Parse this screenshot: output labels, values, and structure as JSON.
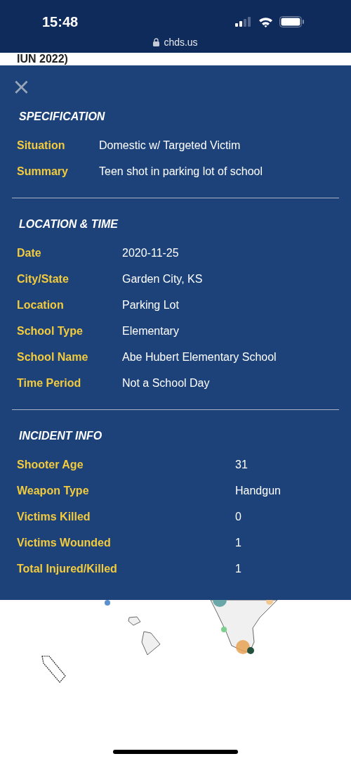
{
  "status_bar": {
    "time": "15:48",
    "url": "chds.us"
  },
  "page_heading": "IUN 2022)",
  "modal": {
    "close": "×",
    "sections": [
      {
        "title": "SPECIFICATION",
        "rows": [
          {
            "label": "Situation",
            "value": "Domestic w/ Targeted Victim"
          },
          {
            "label": "Summary",
            "value": "Teen shot in parking lot of school"
          }
        ]
      },
      {
        "title": "LOCATION & TIME",
        "rows": [
          {
            "label": "Date",
            "value": "2020-11-25"
          },
          {
            "label": "City/State",
            "value": "Garden City, KS"
          },
          {
            "label": "Location",
            "value": "Parking Lot"
          },
          {
            "label": "School Type",
            "value": "Elementary"
          },
          {
            "label": "School Name",
            "value": "Abe Hubert Elementary School"
          },
          {
            "label": "Time Period",
            "value": "Not a School Day"
          }
        ]
      },
      {
        "title": "INCIDENT INFO",
        "rows": [
          {
            "label": "Shooter Age",
            "value": "31"
          },
          {
            "label": "Weapon Type",
            "value": "Handgun"
          },
          {
            "label": "Victims Killed",
            "value": "0"
          },
          {
            "label": "Victims Wounded",
            "value": "1"
          },
          {
            "label": "Total Injured/Killed",
            "value": "1"
          }
        ]
      }
    ]
  }
}
